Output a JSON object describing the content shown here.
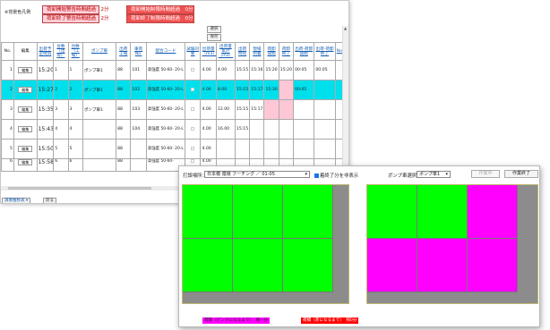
{
  "colors": {
    "selected_row": "#00e0ec",
    "pink": "#ffc7d6",
    "green": "#00ff00",
    "magenta": "#ff00ff",
    "gray": "#8c8c8c",
    "link": "#1560b5"
  },
  "legend": {
    "title": "※背景色凡例",
    "items": [
      "荷卸開始警告時間超過　2分",
      "荷卸終了警告時間超過　2分",
      "荷卸開始制限時間超過　0分",
      "荷卸終了制限時間超過　0分"
    ]
  },
  "buttons": {
    "select": "選択",
    "save": "保存",
    "edit": "編集",
    "footer_left": "演奏推移表",
    "footer_back": "戻る"
  },
  "table": {
    "headers": [
      "No.",
      "編集",
      "出荷予定時刻",
      "台数（出荷）",
      "台数（工場）",
      "ポンプ車",
      "出荷工場",
      "車両No.",
      "配合コード",
      "試験対象",
      "出荷量（m3）",
      "出荷量累計（m3）",
      "出荷時刻",
      "現場到着",
      "荷卸開始",
      "荷卸終了",
      "出荷-荷卸開始",
      "出荷-荷卸終了",
      "No."
    ],
    "rows": [
      {
        "no": "1",
        "time": "15:20",
        "n1": "1",
        "n2": "1",
        "pump": "ポンプ車1",
        "plant": "88",
        "vehicle": "101",
        "mix": "高強度 50-60- 20-L",
        "vol": "4.00",
        "cum": "4.00",
        "t1": "15:15",
        "t2": "15:16",
        "t3": "15:20",
        "t4": "15:20",
        "d1": "00:05",
        "d2": "00:05"
      },
      {
        "no": "2",
        "time": "15:27",
        "n1": "2",
        "n2": "2",
        "pump": "ポンプ車1",
        "plant": "88",
        "vehicle": "102",
        "mix": "高強度 50-60- 20-L",
        "vol": "4.00",
        "cum": "8.00",
        "t1": "15:15",
        "t2": "15:17",
        "t3": "15:30",
        "t4": "",
        "d1": "00:05",
        "d2": ""
      },
      {
        "no": "3",
        "time": "15:35",
        "n1": "3",
        "n2": "3",
        "pump": "ポンプ車1",
        "plant": "88",
        "vehicle": "103",
        "mix": "高強度 50-60- 20-L",
        "vol": "4.00",
        "cum": "12.00",
        "t1": "15:15",
        "t2": "15:17",
        "t3": "",
        "t4": "",
        "d1": "",
        "d2": ""
      },
      {
        "no": "4",
        "time": "15:43",
        "n1": "4",
        "n2": "4",
        "pump": "",
        "plant": "88",
        "vehicle": "104",
        "mix": "高強度 50-60- 20-L",
        "vol": "4.00",
        "cum": "16.00",
        "t1": "15:15",
        "t2": "",
        "t3": "",
        "t4": "",
        "d1": "",
        "d2": ""
      },
      {
        "no": "5",
        "time": "15:50",
        "n1": "5",
        "n2": "5",
        "pump": "",
        "plant": "88",
        "vehicle": "",
        "mix": "高強度 50-60- 20-L",
        "vol": "4.00",
        "cum": "",
        "t1": "",
        "t2": "",
        "t3": "",
        "t4": "",
        "d1": "",
        "d2": ""
      },
      {
        "no": "6",
        "time": "15:58",
        "n1": "6",
        "n2": "6",
        "pump": "",
        "plant": "88",
        "vehicle": "",
        "mix": "高強度 50-60-",
        "vol": "4.00",
        "cum": "",
        "t1": "",
        "t2": "",
        "t3": "",
        "t4": "",
        "d1": "",
        "d2": ""
      }
    ]
  },
  "front": {
    "location_label": "打設場所：",
    "location_value": "日本橋 循環 フーチング ／ 01-05",
    "hide_done_label": "着終了分を非表示",
    "pump_label": "ポンプ車選択：",
    "pump_value": "ポンプ車1",
    "btn_disabled": "作業中",
    "btn_finish": "作業終了",
    "legend_magenta": "荷卸（ピンクになるまで）　残ー分",
    "legend_red": "荷積（赤になるまで）　残0分"
  }
}
